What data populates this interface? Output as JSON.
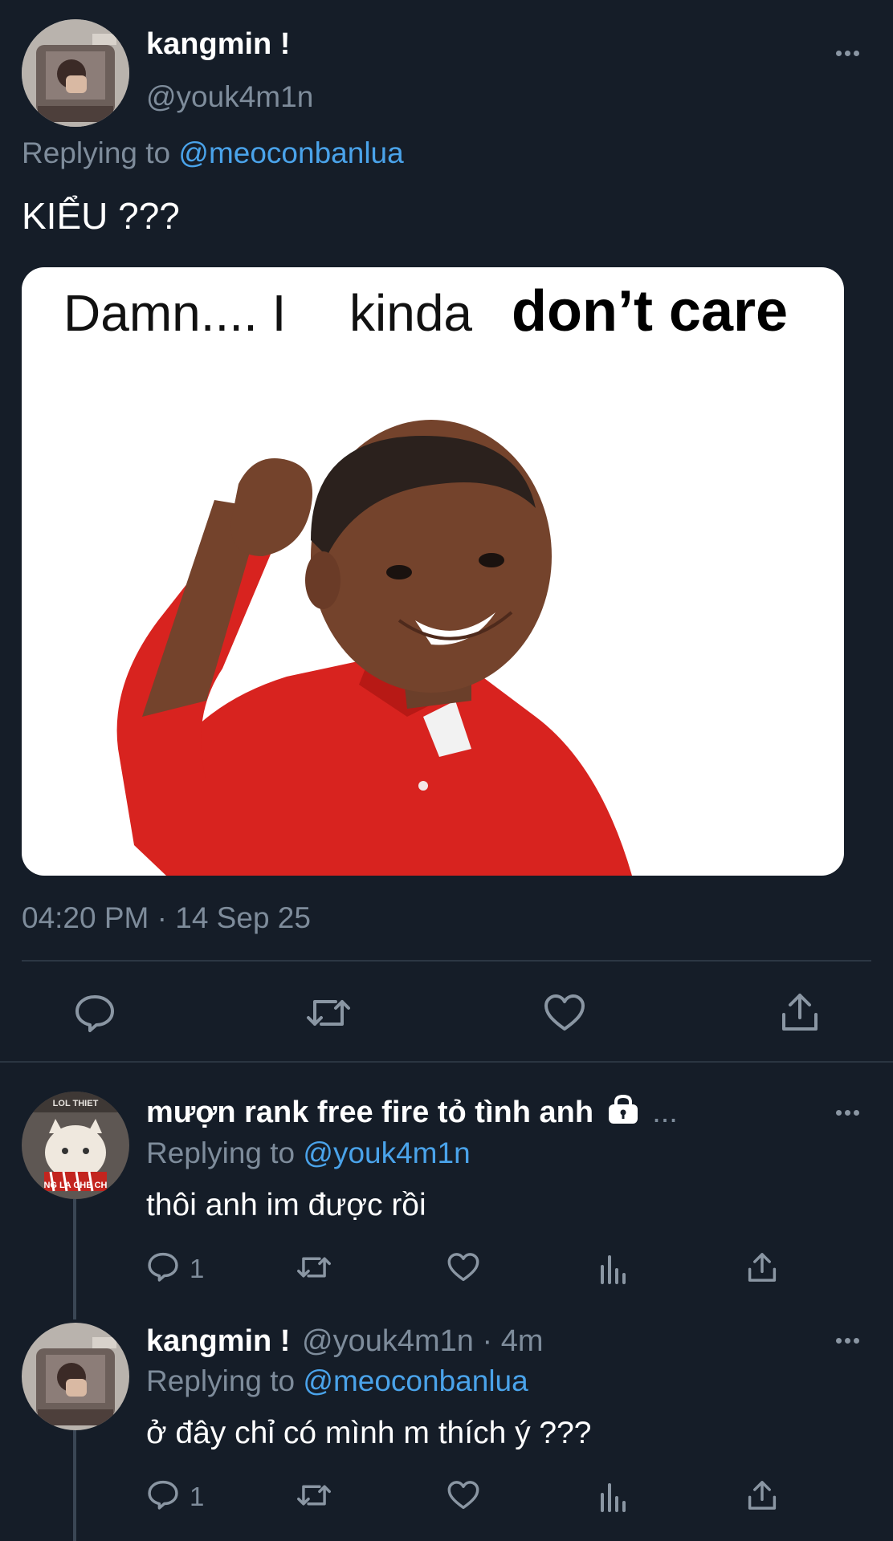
{
  "main_tweet": {
    "display_name": "kangmin !",
    "handle": "@youk4m1n",
    "replying_prefix": "Replying to",
    "replying_to": "@meoconbanlua",
    "text": "KIỂU ???",
    "meme": {
      "caption_part1": "Damn.... I",
      "caption_part2": "kinda",
      "caption_part3": "don’t care"
    },
    "timestamp": "04:20 PM · 14 Sep 25",
    "actions": [
      "reply-icon",
      "retweet-icon",
      "like-icon",
      "share-icon"
    ]
  },
  "replies": [
    {
      "display_name": "mượn rank free fire tỏ tình anh",
      "name_suffix": "...",
      "replying_prefix": "Replying to",
      "replying_to": "@youk4m1n",
      "text": "thôi anh im được rồi",
      "reply_count": "1",
      "avatar_text": "LOL THIET | NG LA CHE CH"
    },
    {
      "display_name": "kangmin !",
      "meta": "@youk4m1n · 4m",
      "replying_prefix": "Replying to",
      "replying_to": "@meoconbanlua",
      "text": "ở đây chỉ có mình m thích ý ???",
      "reply_count": "1"
    }
  ],
  "colors": {
    "background": "#151d28",
    "link": "#4aa3ea",
    "muted": "#7e8c9b",
    "shirt_red": "#d8231f"
  }
}
